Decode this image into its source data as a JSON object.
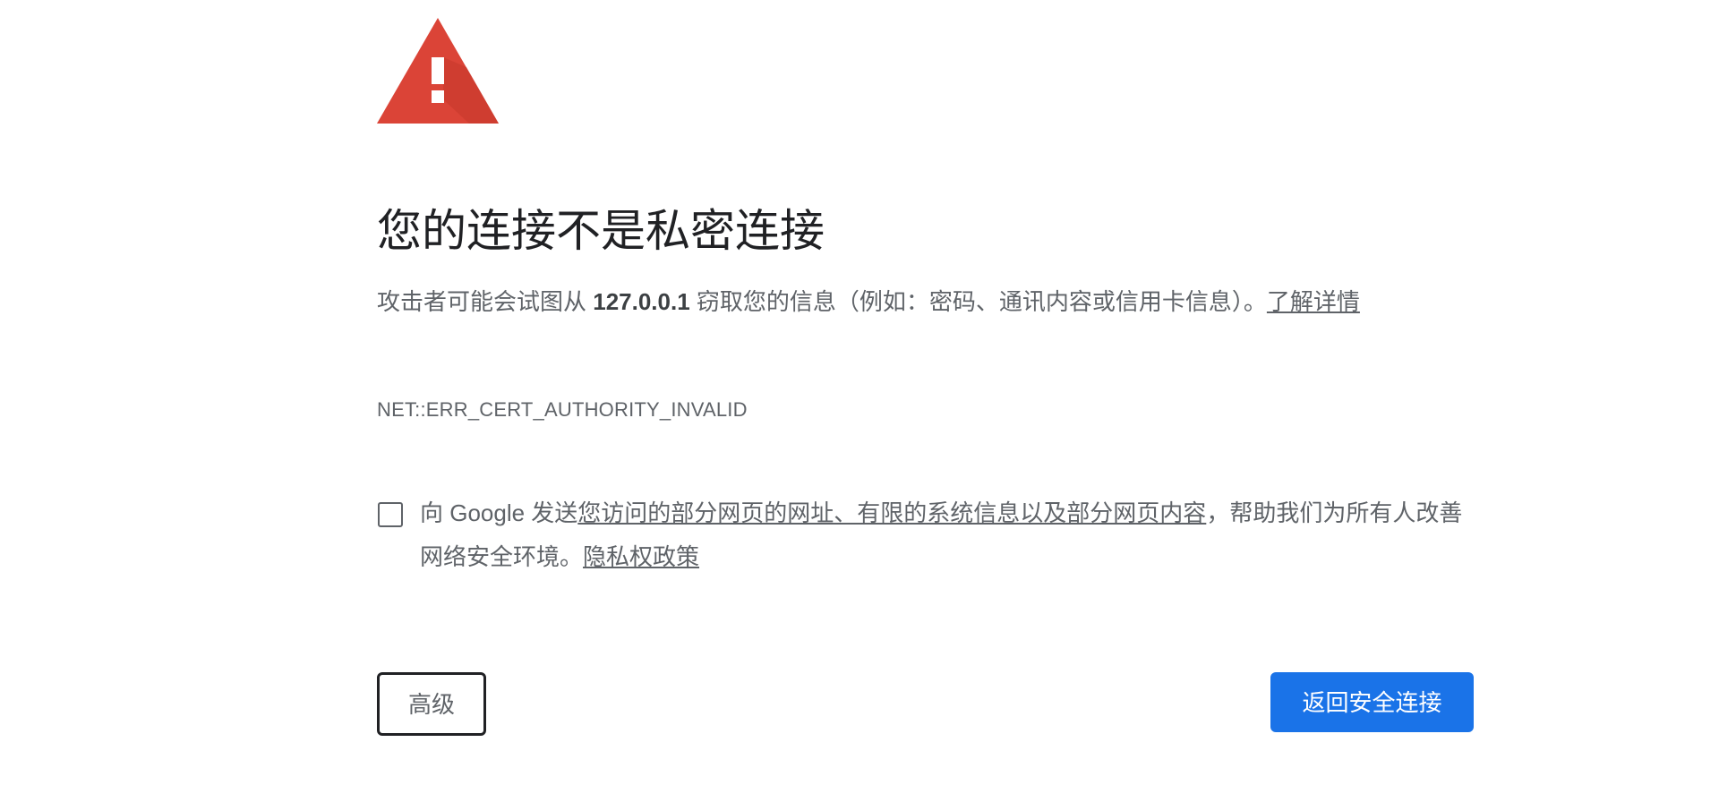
{
  "page_title": "您的连接不是私密连接",
  "message": {
    "before": "攻击者可能会试图从 ",
    "host": "127.0.0.1",
    "after": " 窃取您的信息（例如：密码、通讯内容或信用卡信息）。",
    "learn_more": "了解详情"
  },
  "error_code": "NET::ERR_CERT_AUTHORITY_INVALID",
  "report": {
    "prefix": "向 Google 发送",
    "link": "您访问的部分网页的网址、有限的系统信息以及部分网页内容",
    "suffix": "，帮助我们为所有人改善网络安全环境。",
    "privacy_link": "隐私权政策",
    "checked": false
  },
  "buttons": {
    "advanced": "高级",
    "back_to_safety": "返回安全连接"
  },
  "colors": {
    "warning_red": "#db4437",
    "primary_blue": "#1a73e8",
    "text": "#202124",
    "secondary_text": "#5f6368"
  },
  "icons": {
    "warning": "warning-triangle-icon"
  }
}
